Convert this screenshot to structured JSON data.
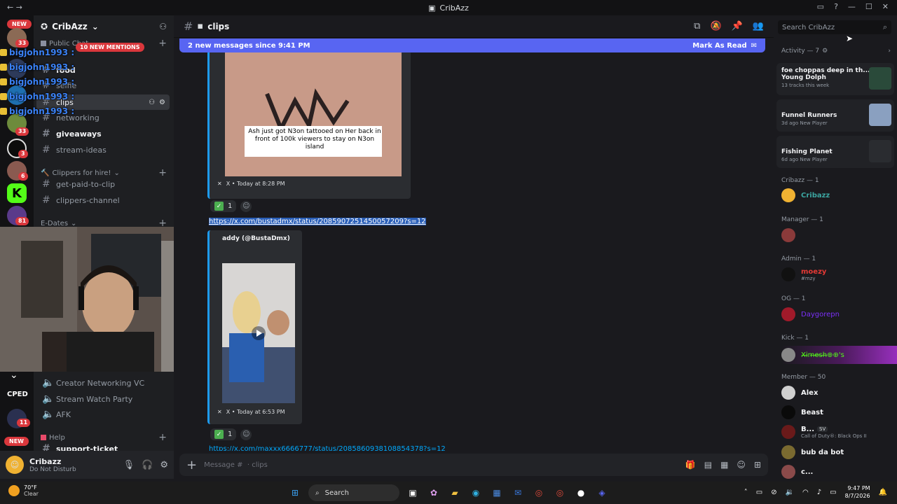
{
  "titlebar": {
    "title": "CribAzz"
  },
  "servers": {
    "new_top": "NEW",
    "badge1": "33",
    "badge2": "99",
    "badge3": "33",
    "badge4": "3",
    "badge5": "6",
    "badge6": "81",
    "badge7": "11",
    "new_bottom": "NEW",
    "cped": "CPED"
  },
  "guild": {
    "name": "CribAzz"
  },
  "mentions_badge": "10 NEW MENTIONS",
  "overlay_mentions": [
    "bigjohn1993 :",
    "bigjohn1993 :",
    "bigjohn1993 :",
    "bigjohn1993 :",
    "bigjohn1993 :"
  ],
  "categories": {
    "public_chat": "Public Chat",
    "clippers": "Clippers for hire!",
    "edates": "E-Dates",
    "help": "Help"
  },
  "channels": {
    "food": "food",
    "selfie": "selfie",
    "clips": "clips",
    "networking": "networking",
    "giveaways": "giveaways",
    "stream_ideas": "stream-ideas",
    "get_paid": "get-paid-to-clip",
    "clippers_channel": "clippers-channel",
    "creator_vc": "Creator Networking VC",
    "watch_party": "Stream Watch Party",
    "afk": "AFK",
    "support": "support-ticket"
  },
  "user": {
    "name": "Cribazz",
    "status": "Do Not Disturb"
  },
  "chat": {
    "channel": "clips",
    "new_messages": "2 new messages since 9:41 PM",
    "mark_read": "Mark As Read",
    "embed1_caption": "Ash just got N3on tattooed on Her back in front of 100k viewers to stay on N3on island",
    "embed1_footer": "X • Today at 8:28 PM",
    "reaction1": "1",
    "link1": "https://x.com/bustadmx/status/2085907251450057209?s=12",
    "embed2_author": "addy (@BustaDmx)",
    "embed2_footer": "X • Today at 6:53 PM",
    "reaction2": "1",
    "link2": "https://x.com/maxxx6666777/status/2085860938108854378?s=12",
    "composer_placeholder": "Message #  · clips"
  },
  "search": {
    "placeholder": "Search CribAzz"
  },
  "members": {
    "activity": "Activity — 7",
    "act1_title": "foe choppas deep in th...",
    "act1_artist": "Young Dolph",
    "act1_sub": "13 tracks this week",
    "act2_title": "Funnel Runners",
    "act2_sub": "3d ago  New Player",
    "act3_title": "Fishing Planet",
    "act3_sub": "6d ago  New Player",
    "sec_cribazz": "Cribazz — 1",
    "m_cribazz": "Cribazz",
    "sec_manager": "Manager — 1",
    "sec_admin": "Admin — 1",
    "m_moezy": "moezy",
    "m_moezy_sub": "#mzy",
    "sec_og": "OG — 1",
    "m_og": "Daygorepn",
    "sec_kick": "Kick — 1",
    "m_kick": "X̶i̶m̶e̶s̶h̶⊕⊕'s",
    "sec_member": "Member — 50",
    "m_alex": "Alex",
    "m_beast": "Beast",
    "m_b": "B...",
    "m_b_tag": "SV",
    "m_b_sub": "Call of Duty®: Black Ops II",
    "m_bub": "bub da bot",
    "m_c": "c..."
  },
  "taskbar": {
    "temp": "70°F",
    "cond": "Clear",
    "search": "Search",
    "time": "9:47 PM",
    "date": "8/7/2026"
  },
  "colors": {
    "blurple": "#5865f2",
    "link": "#00a8fc",
    "cribazz": "#3ba55c",
    "admin": "#e53935",
    "og": "#7b2ff7",
    "kick": "#53fc18"
  }
}
